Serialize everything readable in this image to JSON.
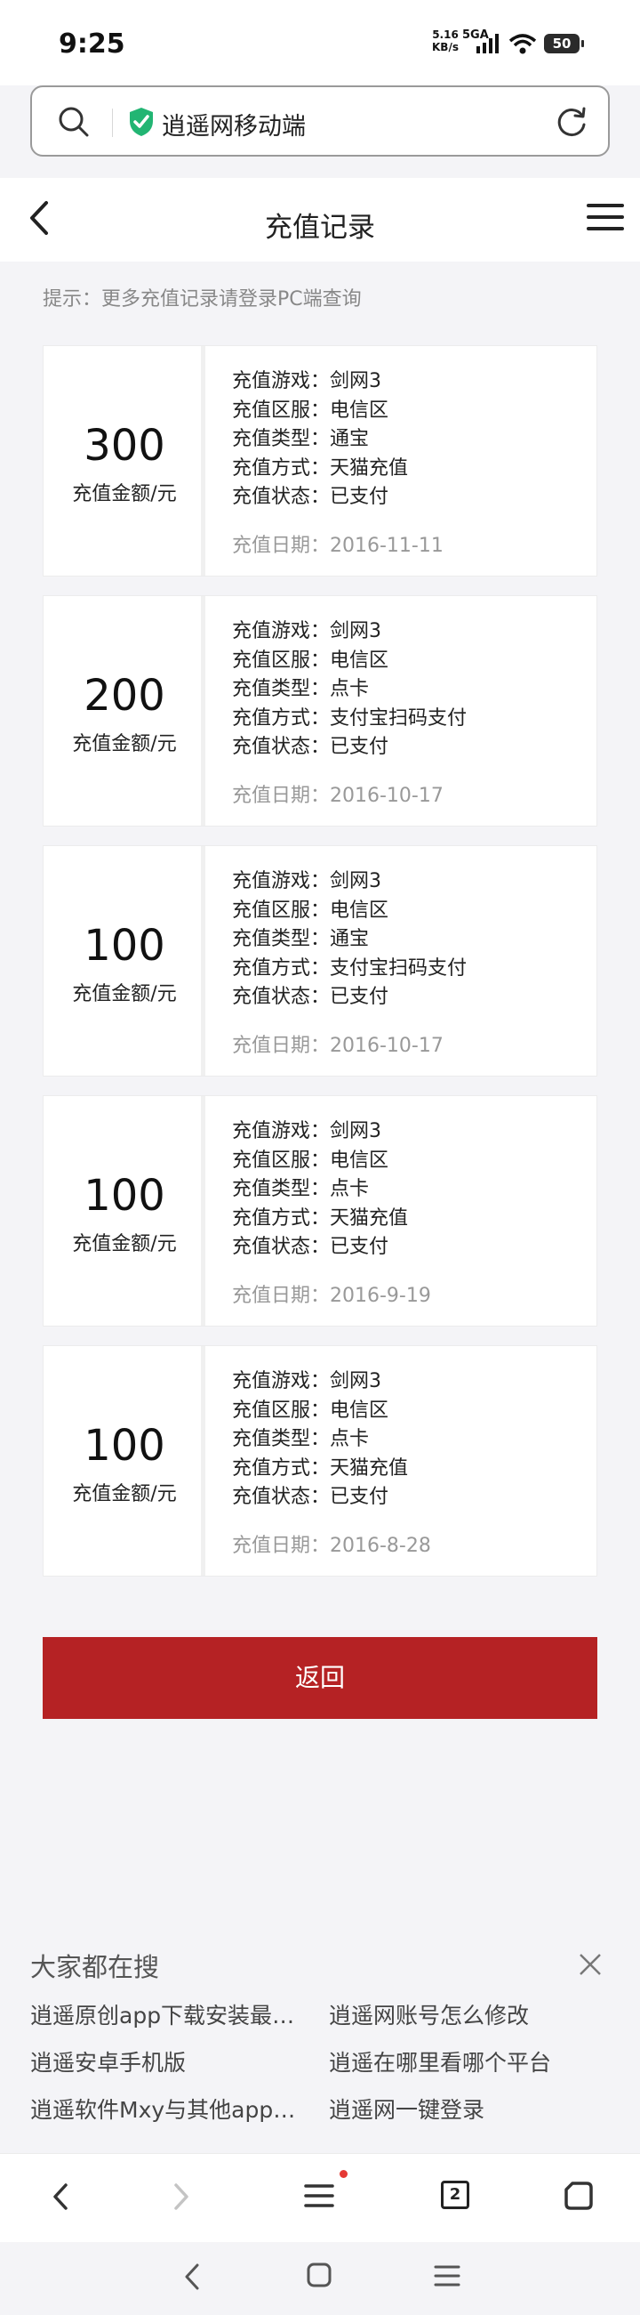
{
  "status": {
    "time": "9:25",
    "speed_value": "5.16",
    "speed_unit": "KB/s",
    "network": "5GA",
    "battery": "50"
  },
  "address": {
    "title": "逍遥网移动端"
  },
  "header": {
    "title": "充值记录"
  },
  "tip": "提示：更多充值记录请登录PC端查询",
  "records": [
    {
      "amount": "300",
      "amount_label": "充值金额/元",
      "game": "充值游戏：剑网3",
      "server": "充值区服：电信区",
      "type": "充值类型：通宝",
      "method": "充值方式：天猫充值",
      "status": "充值状态：已支付",
      "date": "充值日期：2016-11-11"
    },
    {
      "amount": "200",
      "amount_label": "充值金额/元",
      "game": "充值游戏：剑网3",
      "server": "充值区服：电信区",
      "type": "充值类型：点卡",
      "method": "充值方式：支付宝扫码支付",
      "status": "充值状态：已支付",
      "date": "充值日期：2016-10-17"
    },
    {
      "amount": "100",
      "amount_label": "充值金额/元",
      "game": "充值游戏：剑网3",
      "server": "充值区服：电信区",
      "type": "充值类型：通宝",
      "method": "充值方式：支付宝扫码支付",
      "status": "充值状态：已支付",
      "date": "充值日期：2016-10-17"
    },
    {
      "amount": "100",
      "amount_label": "充值金额/元",
      "game": "充值游戏：剑网3",
      "server": "充值区服：电信区",
      "type": "充值类型：点卡",
      "method": "充值方式：天猫充值",
      "status": "充值状态：已支付",
      "date": "充值日期：2016-9-19"
    },
    {
      "amount": "100",
      "amount_label": "充值金额/元",
      "game": "充值游戏：剑网3",
      "server": "充值区服：电信区",
      "type": "充值类型：点卡",
      "method": "充值方式：天猫充值",
      "status": "充值状态：已支付",
      "date": "充值日期：2016-8-28"
    }
  ],
  "return_label": "返回",
  "suggest": {
    "title": "大家都在搜",
    "items": [
      "逍遥原创app下载安装最新版",
      "逍遥网账号怎么修改",
      "逍遥安卓手机版",
      "逍遥在哪里看哪个平台",
      "逍遥软件Mxy与其他app区别",
      "逍遥网一键登录"
    ]
  },
  "browser": {
    "tab_count": "2"
  },
  "colors": {
    "accent": "#b52224",
    "shield": "#22b573"
  }
}
